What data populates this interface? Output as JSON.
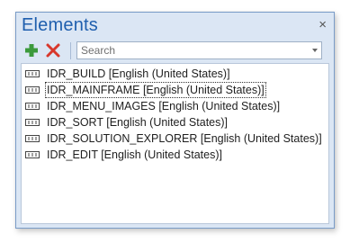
{
  "window": {
    "title": "Elements",
    "close_symbol": "×"
  },
  "toolbar": {
    "add_icon": "plus-icon",
    "delete_icon": "red-x-icon",
    "search": {
      "placeholder": "Search",
      "value": ""
    }
  },
  "elements": {
    "items": [
      {
        "label": "IDR_BUILD [English (United States)]",
        "selected": false
      },
      {
        "label": "IDR_MAINFRAME [English (United States)]",
        "selected": true
      },
      {
        "label": "IDR_MENU_IMAGES [English (United States)]",
        "selected": false
      },
      {
        "label": "IDR_SORT [English (United States)]",
        "selected": false
      },
      {
        "label": "IDR_SOLUTION_EXPLORER [English (United States)]",
        "selected": false
      },
      {
        "label": "IDR_EDIT [English (United States)]",
        "selected": false
      }
    ]
  },
  "colors": {
    "title": "#1f5fae",
    "panel_background": "#dbe6f4",
    "add_icon": "#3c9a3c",
    "delete_icon": "#d8382c"
  }
}
